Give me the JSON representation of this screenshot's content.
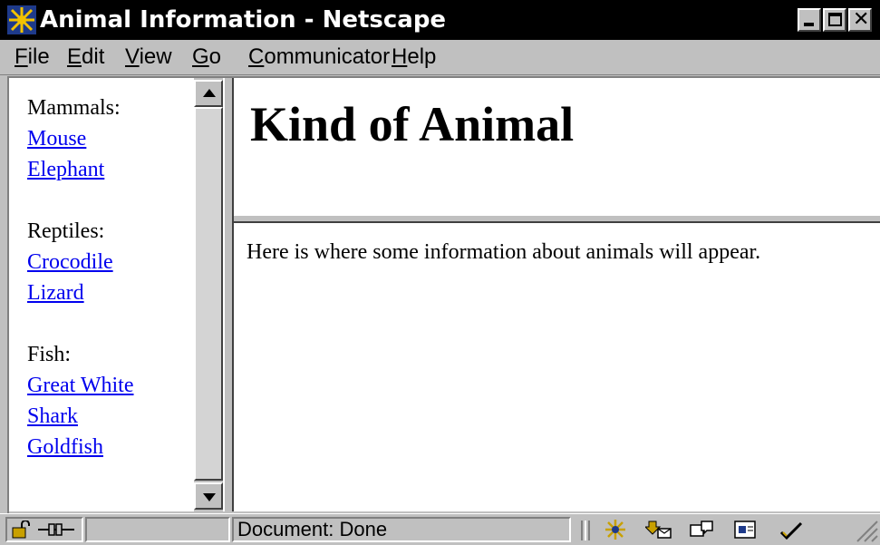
{
  "window": {
    "title": "Animal Information - Netscape",
    "app_icon": "netscape-star-icon"
  },
  "menu": {
    "items": [
      "File",
      "Edit",
      "View",
      "Go",
      "Communicator",
      "Help"
    ]
  },
  "nav": {
    "groups": [
      {
        "heading": "Mammals:",
        "links": [
          "Mouse",
          "Elephant"
        ]
      },
      {
        "heading": "Reptiles:",
        "links": [
          "Crocodile",
          "Lizard"
        ]
      },
      {
        "heading": "Fish:",
        "links": [
          "Great White Shark",
          "Goldfish"
        ]
      }
    ]
  },
  "header_frame": {
    "title": "Kind of Animal"
  },
  "content_frame": {
    "text": "Here is where some information about animals will appear."
  },
  "status": {
    "text": "Document: Done",
    "left_icons": [
      "security-lock-icon",
      "connection-icon"
    ],
    "component_icons": [
      "navigator-icon",
      "mail-icon",
      "discussions-icon",
      "composer-icon",
      "conference-icon"
    ]
  },
  "colors": {
    "chrome": "#c0c0c0",
    "title_bar": "#000000",
    "link": "#0000ee",
    "page_background": "#ffffff"
  }
}
